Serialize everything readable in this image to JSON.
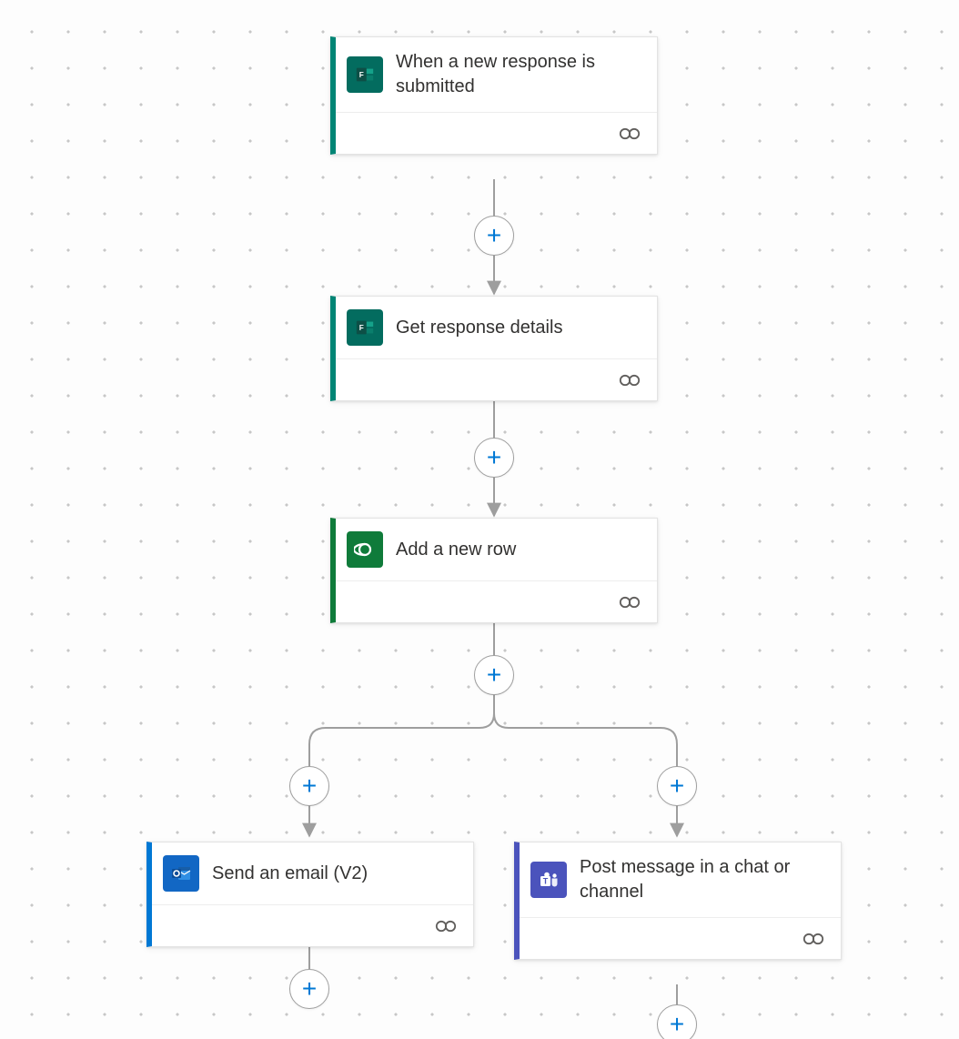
{
  "nodes": {
    "trigger": {
      "title": "When a new response is submitted"
    },
    "details": {
      "title": "Get response details"
    },
    "row": {
      "title": "Add a new row"
    },
    "email": {
      "title": "Send an email (V2)"
    },
    "teams": {
      "title": "Post message in a chat or channel"
    }
  },
  "colors": {
    "formsAccent": "#008575",
    "formsIconBg": "#036c5f",
    "dataverseAccent": "#0f7b3a",
    "dataverseIconBg": "#0f7b3a",
    "outlookAccent": "#0078d4",
    "outlookIconBg": "#1267c4",
    "teamsAccent": "#4b53bc",
    "teamsIconBg": "#4b53bc",
    "addPlus": "#0078d4"
  }
}
